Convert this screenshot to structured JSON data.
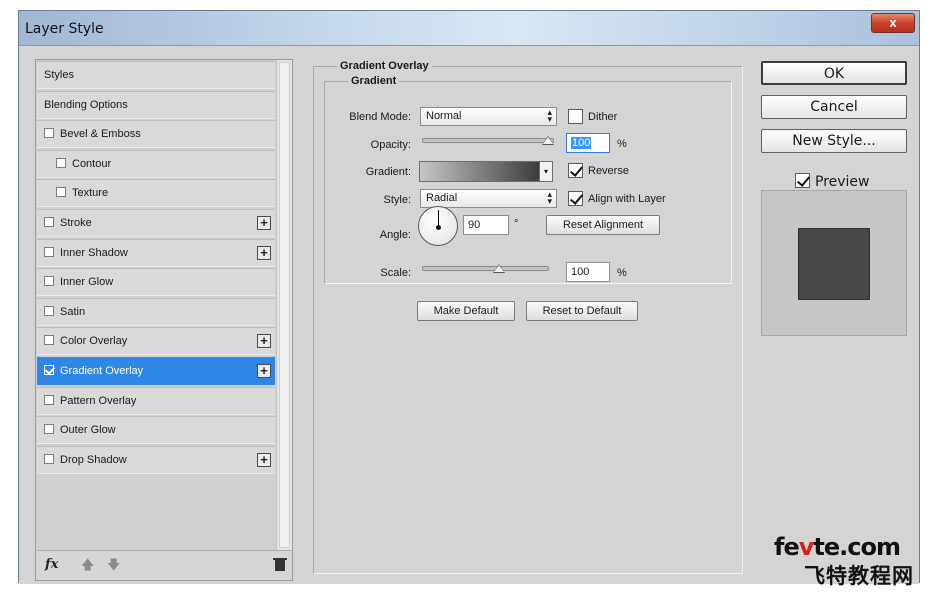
{
  "window": {
    "title": "Layer Style",
    "close_label": "x"
  },
  "styles_list": [
    {
      "label": "Styles",
      "checkbox": false,
      "checked": false,
      "plus": false,
      "sub": false,
      "selected": false
    },
    {
      "label": "Blending Options",
      "checkbox": false,
      "checked": false,
      "plus": false,
      "sub": false,
      "selected": false
    },
    {
      "label": "Bevel & Emboss",
      "checkbox": true,
      "checked": false,
      "plus": false,
      "sub": false,
      "selected": false
    },
    {
      "label": "Contour",
      "checkbox": true,
      "checked": false,
      "plus": false,
      "sub": true,
      "selected": false
    },
    {
      "label": "Texture",
      "checkbox": true,
      "checked": false,
      "plus": false,
      "sub": true,
      "selected": false
    },
    {
      "label": "Stroke",
      "checkbox": true,
      "checked": false,
      "plus": true,
      "sub": false,
      "selected": false
    },
    {
      "label": "Inner Shadow",
      "checkbox": true,
      "checked": false,
      "plus": true,
      "sub": false,
      "selected": false
    },
    {
      "label": "Inner Glow",
      "checkbox": true,
      "checked": false,
      "plus": false,
      "sub": false,
      "selected": false
    },
    {
      "label": "Satin",
      "checkbox": true,
      "checked": false,
      "plus": false,
      "sub": false,
      "selected": false
    },
    {
      "label": "Color Overlay",
      "checkbox": true,
      "checked": false,
      "plus": true,
      "sub": false,
      "selected": false
    },
    {
      "label": "Gradient Overlay",
      "checkbox": true,
      "checked": true,
      "plus": true,
      "sub": false,
      "selected": true
    },
    {
      "label": "Pattern Overlay",
      "checkbox": true,
      "checked": false,
      "plus": false,
      "sub": false,
      "selected": false
    },
    {
      "label": "Outer Glow",
      "checkbox": true,
      "checked": false,
      "plus": false,
      "sub": false,
      "selected": false
    },
    {
      "label": "Drop Shadow",
      "checkbox": true,
      "checked": false,
      "plus": true,
      "sub": false,
      "selected": false
    }
  ],
  "list_footer": {
    "fx": "fx",
    "up_icon": "arrow-up-icon",
    "down_icon": "arrow-down-icon",
    "trash_icon": "trash-icon"
  },
  "gradient_overlay": {
    "section_title": "Gradient Overlay",
    "group_title": "Gradient",
    "blend_mode": {
      "label": "Blend Mode:",
      "value": "Normal"
    },
    "dither": {
      "label": "Dither",
      "checked": false
    },
    "opacity": {
      "label": "Opacity:",
      "value": "100",
      "unit": "%",
      "level": 1.0
    },
    "gradient": {
      "label": "Gradient:",
      "colors": [
        "#c6c6c6",
        "#3b3b3b"
      ]
    },
    "reverse": {
      "label": "Reverse",
      "checked": true
    },
    "style": {
      "label": "Style:",
      "value": "Radial"
    },
    "align_with_layer": {
      "label": "Align with Layer",
      "checked": true
    },
    "angle": {
      "label": "Angle:",
      "value": "90",
      "unit": "°"
    },
    "reset_alignment": "Reset Alignment",
    "scale": {
      "label": "Scale:",
      "value": "100",
      "unit": "%"
    },
    "make_default": "Make Default",
    "reset_to_default": "Reset to Default"
  },
  "buttons": {
    "ok": "OK",
    "cancel": "Cancel",
    "new_style": "New Style..."
  },
  "preview": {
    "label": "Preview",
    "checked": true,
    "swatch_color": "#474747"
  },
  "watermark": {
    "line1_a": "fe",
    "line1_b": "v",
    "line1_c": "te.com",
    "line2": "飞特教程网"
  }
}
